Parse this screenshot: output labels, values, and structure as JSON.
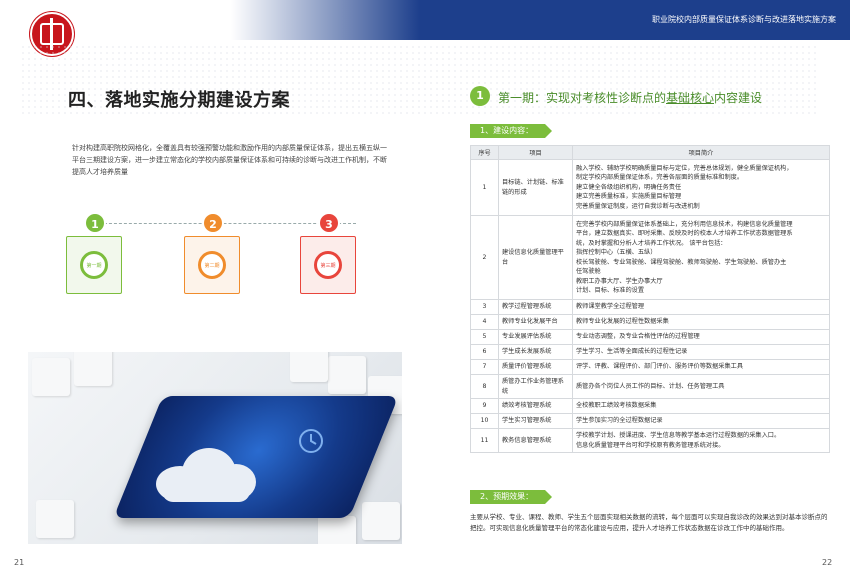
{
  "header": {
    "title": "职业院校内部质量保证体系诊断与改进落地实施方案"
  },
  "left": {
    "section_title": "四、落地实施分期建设方案",
    "intro": "针对构建高职院校网格化，全覆盖具有较强预警功能和激励作用的内部质量保证体系，提出五横五纵一平台三期建设方案，进一步建立常态化的学校内部质量保证体系和可持续的诊断与改进工作机制，不断提高人才培养质量",
    "stages": [
      {
        "num": "1",
        "label": "第一期",
        "color": "#7cbd3c",
        "card_bg": "#f2f8ec"
      },
      {
        "num": "2",
        "label": "第二期",
        "color": "#f08c2c",
        "card_bg": "#fdf3ea"
      },
      {
        "num": "3",
        "label": "第三期",
        "color": "#e8453c",
        "card_bg": "#fcecea"
      }
    ],
    "page_number": "21"
  },
  "right": {
    "phase_num": "1",
    "phase_title_a": "第一期：实现对考核性诊断点的",
    "phase_title_b": "基础核心",
    "phase_title_c": "内容建设",
    "tag_build": "1、建设内容：",
    "table": {
      "headers": [
        "序号",
        "项目",
        "项目简介"
      ],
      "rows": [
        {
          "no": "1",
          "item": "目标链、计划链、标准链的形成",
          "desc": [
            "融入学校、辅助学校明确质量目标与定位，完善总体规划，健全质量保证机构，",
            "制定学校内部质量保证体系，完善各层面的质量标准和制度。",
            "建立健全各级组织机构，明确任务责任",
            "建立完善质量标准，实施质量目标管理",
            "完善质量保证制度，运行自我诊断与改进机制"
          ]
        },
        {
          "no": "2",
          "item": "建设信息化质量管理平台",
          "desc": [
            "在完善学校内部质量保证体系基础上，充分利用信息技术，构建信息化质量管理",
            "平台，建立数据真实、即时采集、反映及时的校本人才培养工作状态数据管理系",
            "统，及时掌握和分析人才培养工作状况。 该平台包括：",
            "指挥控制中心（五横、五纵）",
            "校长驾驶舱、专业驾驶舱、课程驾驶舱、教师驾驶舱、学生驾驶舱、质管办主",
            "任驾驶舱",
            "教职工办事大厅、学生办事大厅",
            "计划、目标、标准的设置"
          ]
        },
        {
          "no": "3",
          "item": "教学过程管理系统",
          "desc": [
            "教师课堂教学全过程管理"
          ]
        },
        {
          "no": "4",
          "item": "教师专业化发展平台",
          "desc": [
            "教师专业化发展的过程性数据采集"
          ]
        },
        {
          "no": "5",
          "item": "专业发展评估系统",
          "desc": [
            "专业动态调整，及专业合格性评估的过程管理"
          ]
        },
        {
          "no": "6",
          "item": "学生成长发展系统",
          "desc": [
            "学生学习、生活等全面成长的过程性记录"
          ]
        },
        {
          "no": "7",
          "item": "质量评价管理系统",
          "desc": [
            "评学、评教、课程评价、部门评价、服务评价等数据采集工具"
          ]
        },
        {
          "no": "8",
          "item": "质管办工作业务管理系统",
          "desc": [
            "质管办各个岗位人员工作的目标、计划、任务管理工具"
          ]
        },
        {
          "no": "9",
          "item": "绩效考核管理系统",
          "desc": [
            "全校教职工绩效考核数据采集"
          ]
        },
        {
          "no": "10",
          "item": "学生实习管理系统",
          "desc": [
            "学生参加实习的全过程数据记录"
          ]
        },
        {
          "no": "11",
          "item": "教务信息管理系统",
          "desc": [
            "学校教学计划、授课进度、学生信息等教学基本运行过程数据的采集入口。",
            "信息化质量管理平台可和学校原有教务管理系统对接。"
          ]
        }
      ]
    },
    "tag_effect": "2、预期效果：",
    "effect_text": "主要从学校、专业、课程、教师、学生五个层面实现相关数据的流转，每个层面可以实现自我诊改的效果达到对基本诊断点的把控。可实现信息化质量管理平台的常态化建设与应用，提升人才培养工作状态数据在诊改工作中的基础作用。",
    "page_number": "22"
  }
}
